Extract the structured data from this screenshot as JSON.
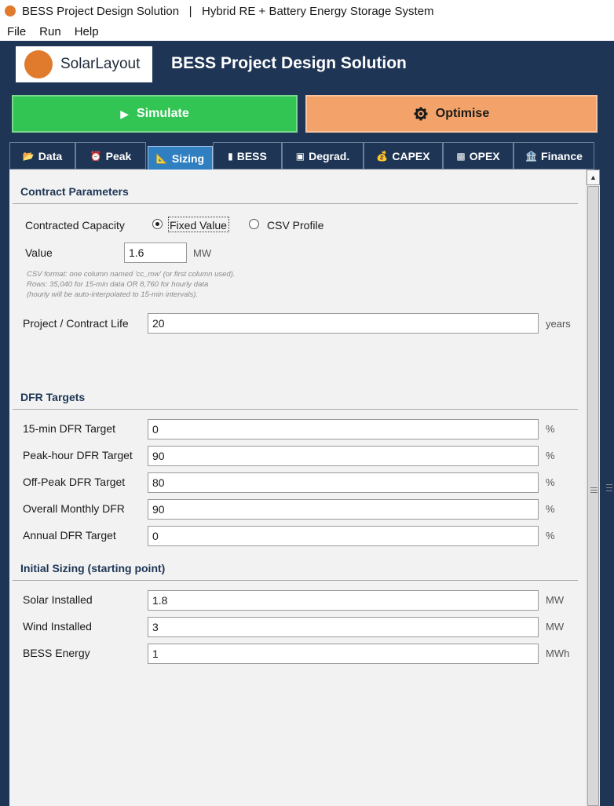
{
  "window": {
    "title": "BESS Project Design Solution   |   Hybrid RE + Battery Energy Storage System",
    "icon": "app-icon"
  },
  "menu": {
    "items": [
      "File",
      "Run",
      "Help"
    ]
  },
  "brand": {
    "logo_text": "SolarLayout",
    "app_title": "BESS Project Design Solution"
  },
  "actions": {
    "simulate_label": "Simulate",
    "optimise_label": "Optimise"
  },
  "tabs": [
    {
      "label": "Data",
      "icon": "folder-icon"
    },
    {
      "label": "Peak",
      "icon": "alarm-clock-icon"
    },
    {
      "label": "Sizing",
      "icon": "ruler-icon",
      "active": true
    },
    {
      "label": "BESS",
      "icon": "battery-icon"
    },
    {
      "label": "Degrad.",
      "icon": "chart-icon"
    },
    {
      "label": "CAPEX",
      "icon": "money-bag-icon"
    },
    {
      "label": "OPEX",
      "icon": "box-icon"
    },
    {
      "label": "Finance",
      "icon": "bank-icon"
    }
  ],
  "contract": {
    "heading": "Contract Parameters",
    "capacity_label": "Contracted Capacity",
    "radio_fixed": "Fixed Value",
    "radio_csv": "CSV Profile",
    "selected": "Fixed Value",
    "value_label": "Value",
    "value": "1.6",
    "value_unit": "MW",
    "hint_lines": [
      "CSV format: one column named 'cc_mw' (or first column used).",
      "Rows: 35,040 for 15-min data  OR  8,760 for hourly data",
      "(hourly will be auto-interpolated to 15-min intervals)."
    ],
    "life_label": "Project / Contract Life",
    "life_value": "20",
    "life_unit": "years"
  },
  "dfr": {
    "heading": "DFR Targets",
    "rows": [
      {
        "label": "15-min DFR Target",
        "value": "0",
        "unit": "%"
      },
      {
        "label": "Peak-hour DFR Target",
        "value": "90",
        "unit": "%"
      },
      {
        "label": "Off-Peak DFR Target",
        "value": "80",
        "unit": "%"
      },
      {
        "label": "Overall Monthly DFR",
        "value": "90",
        "unit": "%"
      },
      {
        "label": "Annual DFR Target",
        "value": "0",
        "unit": "%"
      }
    ]
  },
  "sizing": {
    "heading": "Initial Sizing  (starting point)",
    "rows": [
      {
        "label": "Solar Installed",
        "value": "1.8",
        "unit": "MW"
      },
      {
        "label": "Wind Installed",
        "value": "3",
        "unit": "MW"
      },
      {
        "label": "BESS Energy",
        "value": "1",
        "unit": "MWh"
      }
    ]
  },
  "colors": {
    "header_bg": "#1f3555",
    "simulate_bg": "#33c553",
    "optimise_bg": "#f3a36a",
    "active_tab": "#2f7fc1",
    "brand_orange": "#e07b2e"
  }
}
